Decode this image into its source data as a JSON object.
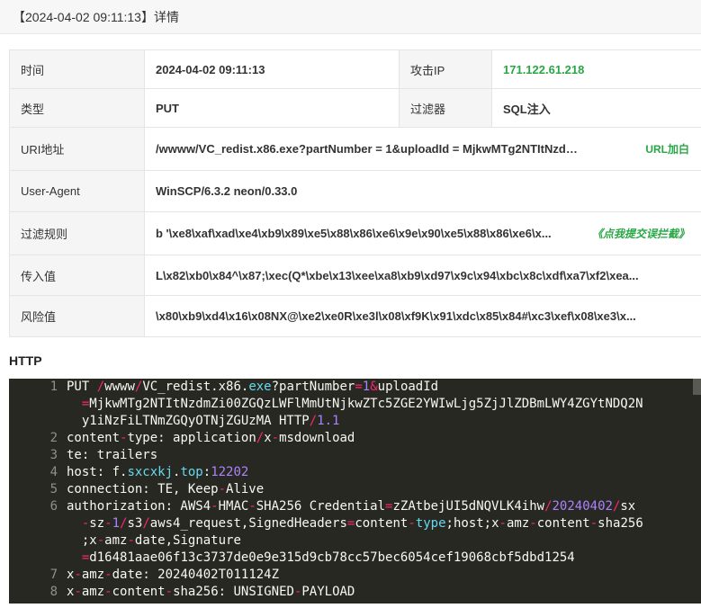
{
  "page": {
    "title": "【2024-04-02 09:11:13】详情"
  },
  "info": {
    "time_label": "时间",
    "time_value": "2024-04-02 09:11:13",
    "attack_ip_label": "攻击IP",
    "attack_ip_value": "171.122.61.218",
    "type_label": "类型",
    "type_value": "PUT",
    "filter_label": "过滤器",
    "filter_value": "SQL注入",
    "uri_label": "URI地址",
    "uri_value": "/wwww/VC_redist.x86.exe?partNumber = 1&uploadId = MjkwMTg2NTItNzdm...",
    "uri_action": "URL加白",
    "ua_label": "User-Agent",
    "ua_value": "WinSCP/6.3.2 neon/0.33.0",
    "rule_label": "过滤规则",
    "rule_value": "b  '\\xe8\\xaf\\xad\\xe4\\xb9\\x89\\xe5\\x88\\x86\\xe6\\x9e\\x90\\xe5\\x88\\x86\\xe6\\x...",
    "rule_action": "《点我提交误拦截》",
    "input_label": "传入值",
    "input_value": "L\\x82\\xb0\\x84^\\x87;\\xec(Q*\\xbe\\x13\\xee\\xa8\\xb9\\xd97\\x9c\\x94\\xbc\\x8c\\xdf\\xa7\\xf2\\xea...",
    "risk_label": "风险值",
    "risk_value": "\\x80\\xb9\\xd4\\x16\\x08NX@\\xe2\\xe0R\\xe3l\\x08\\xf9K\\x91\\xdc\\x85\\x84#\\xc3\\xef\\x08\\xe3\\x..."
  },
  "http": {
    "heading": "HTTP"
  },
  "colors": {
    "accent_green": "#28a745",
    "code_bg": "#272822"
  }
}
